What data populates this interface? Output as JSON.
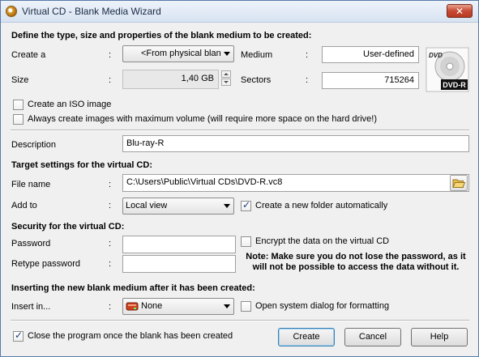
{
  "window": {
    "title": "Virtual CD - Blank Media Wizard",
    "close_glyph": "✕"
  },
  "section1": {
    "heading": "Define the type, size and properties of the blank medium to be created:",
    "create_a_label": "Create a",
    "create_a_value": "<From physical blan",
    "medium_label": "Medium",
    "medium_value": "User-defined",
    "size_label": "Size",
    "size_value": "1,40 GB",
    "sectors_label": "Sectors",
    "sectors_value": "715264",
    "disc_label": "DVD-R",
    "disc_logo": "DVD",
    "iso_label": "Create an ISO image",
    "max_volume_label": "Always create images with maximum volume (will require more space on the hard drive!)"
  },
  "description": {
    "label": "Description",
    "value": "Blu-ray-R"
  },
  "target": {
    "heading": "Target settings for the virtual CD:",
    "file_name_label": "File name",
    "file_name_value": "C:\\Users\\Public\\Virtual CDs\\DVD-R.vc8",
    "add_to_label": "Add to",
    "add_to_value": "Local view",
    "new_folder_label": "Create a new folder automatically"
  },
  "security": {
    "heading": "Security for the virtual CD:",
    "password_label": "Password",
    "retype_label": "Retype password",
    "encrypt_label": "Encrypt the data on the virtual CD",
    "note": "Note: Make sure you do not lose the password, as it will not be possible to access the data without it."
  },
  "insert": {
    "heading": "Inserting the new blank medium after it has been created:",
    "insert_label": "Insert in...",
    "insert_value": "None",
    "open_dialog_label": "Open system dialog for formatting"
  },
  "footer": {
    "close_program_label": "Close the program once the blank has been created",
    "create_button": "Create",
    "cancel_button": "Cancel",
    "help_button": "Help"
  },
  "colon": ":",
  "states": {
    "iso_checked": false,
    "max_volume_checked": false,
    "new_folder_checked": true,
    "encrypt_checked": false,
    "open_dialog_checked": false,
    "close_program_checked": true
  },
  "icons": [
    "app-disc-icon",
    "close-icon",
    "folder-open-icon",
    "drive-icon",
    "dvd-disc-icon",
    "chevron-down-icon"
  ]
}
